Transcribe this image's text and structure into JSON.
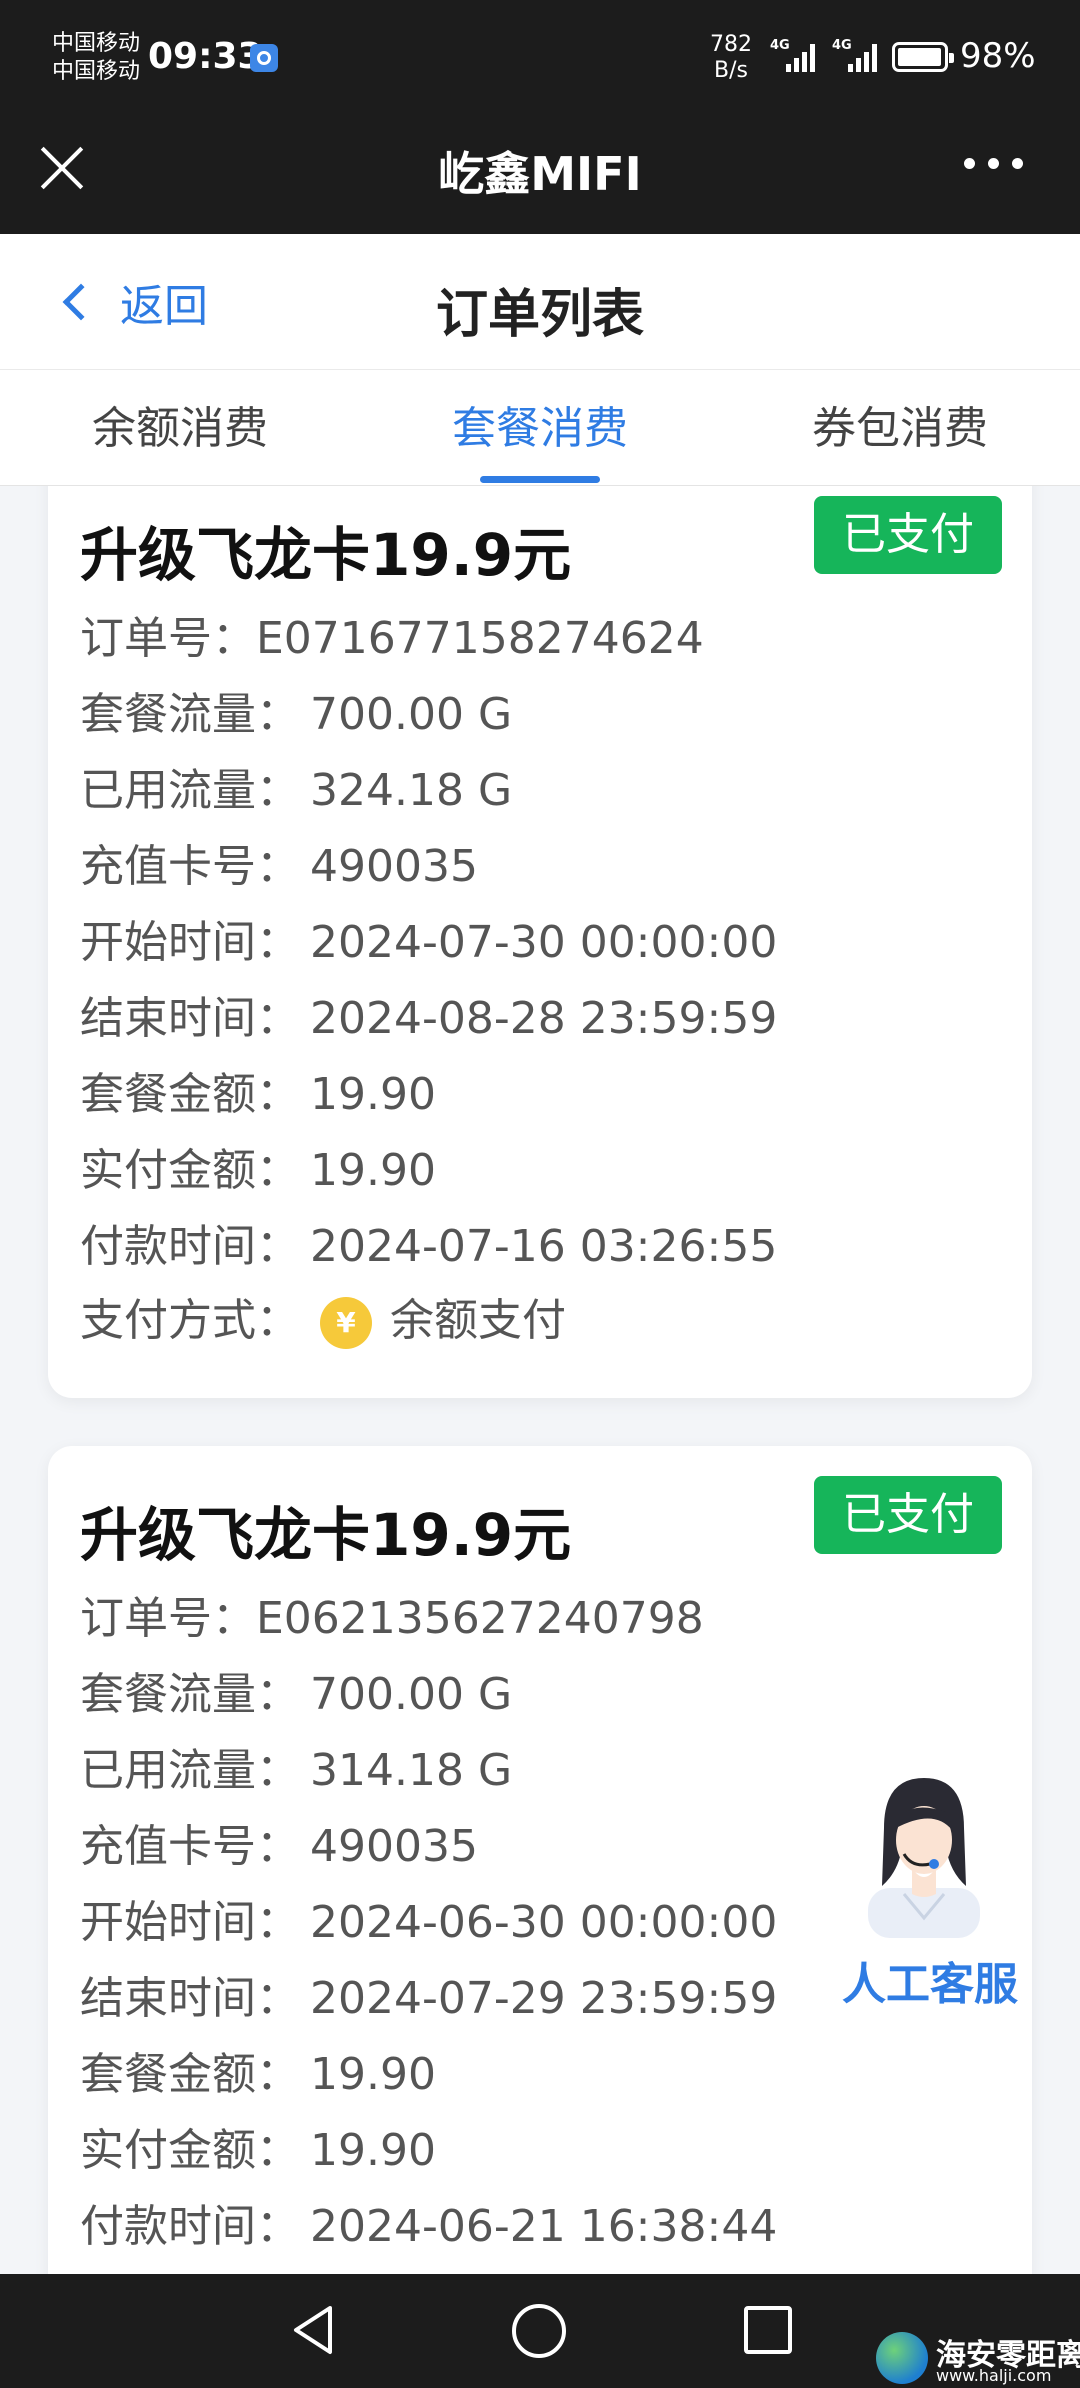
{
  "status_bar": {
    "carrier_1": "中国移动",
    "carrier_2": "中国移动",
    "time": "09:33",
    "net_speed_value": "782",
    "net_speed_unit": "B/s",
    "signal_1_tag": "4G",
    "signal_2_tag": "4G",
    "battery_percent": "98%",
    "battery_level": 0.98
  },
  "app_bar": {
    "title": "屹鑫MIFI"
  },
  "nav": {
    "back_label": "返回",
    "title": "订单列表"
  },
  "tabs": [
    {
      "label": "余额消费",
      "active": false
    },
    {
      "label": "套餐消费",
      "active": true
    },
    {
      "label": "券包消费",
      "active": false
    }
  ],
  "orders": [
    {
      "title": "升级飞龙卡19.9元",
      "status": "已支付",
      "fields": [
        {
          "key": "订单号：",
          "value": "E071677158274624"
        },
        {
          "key": "套餐流量：",
          "value": "700.00 G"
        },
        {
          "key": "已用流量：",
          "value": "324.18 G"
        },
        {
          "key": "充值卡号：",
          "value": "490035"
        },
        {
          "key": "开始时间：",
          "value": "2024-07-30 00:00:00"
        },
        {
          "key": "结束时间：",
          "value": "2024-08-28 23:59:59"
        },
        {
          "key": "套餐金额：",
          "value": "19.90"
        },
        {
          "key": "实付金额：",
          "value": "19.90"
        },
        {
          "key": "付款时间：",
          "value": "2024-07-16 03:26:55"
        }
      ],
      "payment_method_key": "支付方式：",
      "payment_method_icon": "¥",
      "payment_method_value": "余额支付"
    },
    {
      "title": "升级飞龙卡19.9元",
      "status": "已支付",
      "fields": [
        {
          "key": "订单号：",
          "value": "E062135627240798"
        },
        {
          "key": "套餐流量：",
          "value": "700.00 G"
        },
        {
          "key": "已用流量：",
          "value": "314.18 G"
        },
        {
          "key": "充值卡号：",
          "value": "490035"
        },
        {
          "key": "开始时间：",
          "value": "2024-06-30 00:00:00"
        },
        {
          "key": "结束时间：",
          "value": "2024-07-29 23:59:59"
        },
        {
          "key": "套餐金额：",
          "value": "19.90"
        },
        {
          "key": "实付金额：",
          "value": "19.90"
        },
        {
          "key": "付款时间：",
          "value": "2024-06-21 16:38:44"
        }
      ]
    }
  ],
  "customer_service": {
    "label": "人工客服"
  },
  "watermark": {
    "text": "海安零距离",
    "url": "www.halji.com"
  },
  "colors": {
    "accent": "#2f7ce3",
    "paid_badge": "#16b55a",
    "dark_bar": "#1c1c1c"
  }
}
